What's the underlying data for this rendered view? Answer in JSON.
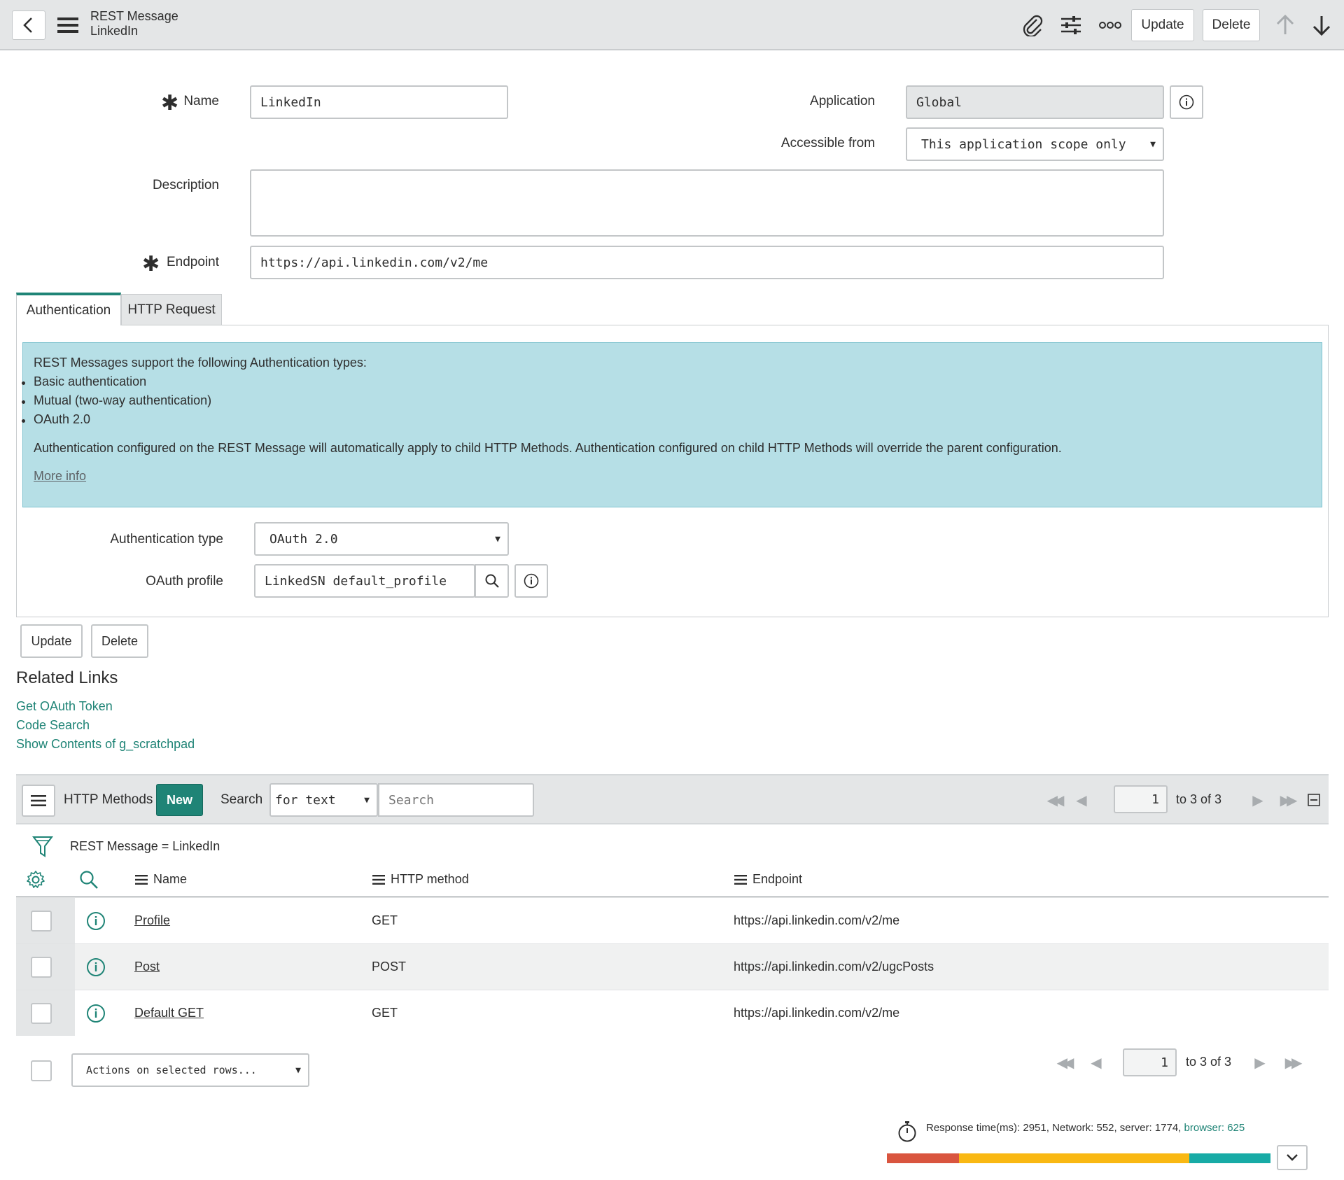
{
  "header": {
    "title": "REST Message",
    "subtitle": "LinkedIn",
    "update_label": "Update",
    "delete_label": "Delete"
  },
  "form": {
    "name_label": "Name",
    "name_value": "LinkedIn",
    "application_label": "Application",
    "application_value": "Global",
    "accessible_label": "Accessible from",
    "accessible_value": "This application scope only",
    "description_label": "Description",
    "description_value": "",
    "endpoint_label": "Endpoint",
    "endpoint_value": "https://api.linkedin.com/v2/me"
  },
  "tabs": [
    {
      "label": "Authentication",
      "active": true
    },
    {
      "label": "HTTP Request",
      "active": false
    }
  ],
  "info": {
    "intro": "REST Messages support the following Authentication types:",
    "items": [
      "Basic authentication",
      "Mutual (two-way authentication)",
      "OAuth 2.0"
    ],
    "note": "Authentication configured on the REST Message will automatically apply to child HTTP Methods. Authentication configured on child HTTP Methods will override the parent configuration.",
    "more_info": "More info"
  },
  "auth": {
    "type_label": "Authentication type",
    "type_value": "OAuth 2.0",
    "profile_label": "OAuth profile",
    "profile_value": "LinkedSN default_profile"
  },
  "actions": {
    "update_label": "Update",
    "delete_label": "Delete"
  },
  "related": {
    "title": "Related Links",
    "links": [
      "Get OAuth Token",
      "Code Search",
      "Show Contents of g_scratchpad"
    ]
  },
  "list": {
    "title": "HTTP Methods",
    "new_label": "New",
    "search_label": "Search",
    "search_field_value": "for text",
    "search_placeholder": "Search",
    "page_value": "1",
    "page_range": "to 3 of 3",
    "filter_text": "REST Message = LinkedIn",
    "columns": [
      "Name",
      "HTTP method",
      "Endpoint"
    ],
    "rows": [
      {
        "name": "Profile",
        "method": "GET",
        "endpoint": "https://api.linkedin.com/v2/me"
      },
      {
        "name": "Post",
        "method": "POST",
        "endpoint": "https://api.linkedin.com/v2/ugcPosts"
      },
      {
        "name": "Default GET",
        "method": "GET",
        "endpoint": "https://api.linkedin.com/v2/me"
      }
    ],
    "actions_value": "Actions on selected rows...",
    "bottom_page_value": "1",
    "bottom_page_range": "to 3 of 3"
  },
  "perf": {
    "text": "Response time(ms): 2951, Network: 552, server: 1774,",
    "browser_text": "browser: 625",
    "network_ms": 552,
    "server_ms": 1774,
    "browser_ms": 625
  },
  "colors": {
    "accent": "#1f8476",
    "info_bg": "#b6dfe6",
    "network": "#d9553f",
    "server": "#f9b813",
    "browser": "#18aba6"
  }
}
